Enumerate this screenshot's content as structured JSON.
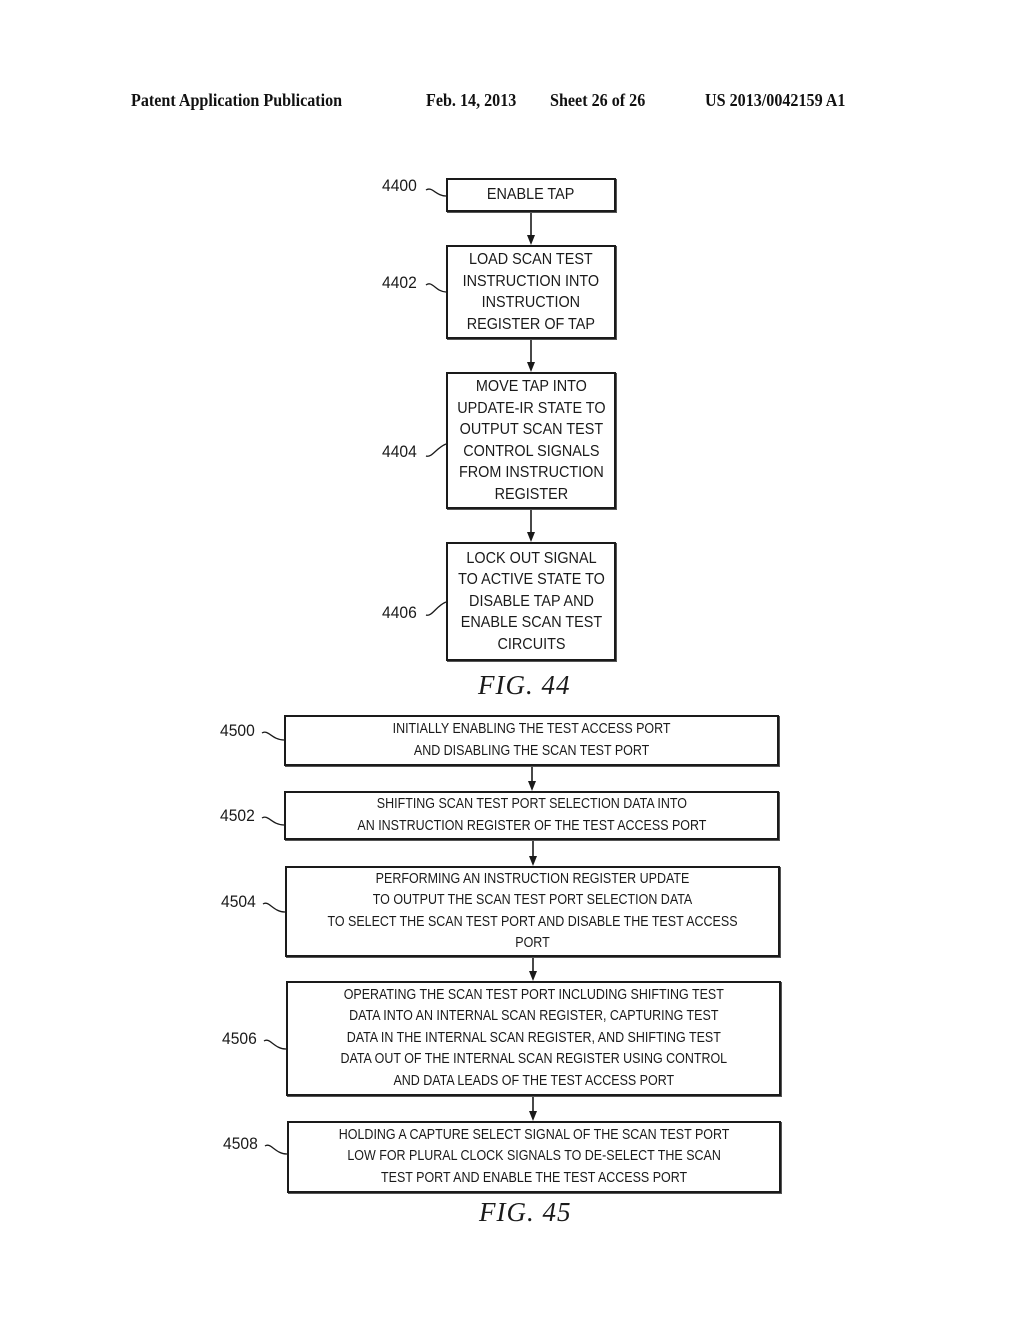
{
  "header": {
    "publication": "Patent Application Publication",
    "date": "Feb. 14, 2013",
    "sheet": "Sheet 26 of 26",
    "number": "US 2013/0042159 A1"
  },
  "fig44": {
    "caption": "FIG. 44",
    "steps": [
      {
        "ref": "4400",
        "text": "ENABLE TAP"
      },
      {
        "ref": "4402",
        "text": "LOAD SCAN TEST\nINSTRUCTION INTO\nINSTRUCTION\nREGISTER OF TAP"
      },
      {
        "ref": "4404",
        "text": "MOVE TAP INTO\nUPDATE-IR STATE TO\nOUTPUT SCAN TEST\nCONTROL SIGNALS\nFROM INSTRUCTION\nREGISTER"
      },
      {
        "ref": "4406",
        "text": "LOCK OUT SIGNAL\nTO ACTIVE STATE TO\nDISABLE TAP AND\nENABLE SCAN TEST\nCIRCUITS"
      }
    ]
  },
  "fig45": {
    "caption": "FIG. 45",
    "steps": [
      {
        "ref": "4500",
        "text": "INITIALLY ENABLING THE TEST ACCESS PORT\nAND DISABLING THE SCAN TEST PORT"
      },
      {
        "ref": "4502",
        "text": "SHIFTING SCAN TEST PORT SELECTION DATA INTO\nAN INSTRUCTION REGISTER OF THE TEST ACCESS PORT"
      },
      {
        "ref": "4504",
        "text": "PERFORMING AN INSTRUCTION REGISTER UPDATE\nTO OUTPUT THE SCAN TEST PORT SELECTION DATA\nTO SELECT THE SCAN TEST PORT AND DISABLE THE TEST ACCESS PORT"
      },
      {
        "ref": "4506",
        "text": "OPERATING THE SCAN TEST PORT INCLUDING SHIFTING TEST\nDATA INTO AN INTERNAL SCAN REGISTER, CAPTURING TEST\nDATA IN THE INTERNAL SCAN REGISTER, AND SHIFTING TEST\nDATA OUT OF THE INTERNAL SCAN REGISTER USING CONTROL\nAND DATA LEADS OF THE TEST ACCESS PORT"
      },
      {
        "ref": "4508",
        "text": "HOLDING A CAPTURE SELECT SIGNAL OF THE SCAN TEST PORT\nLOW FOR PLURAL CLOCK SIGNALS TO DE-SELECT THE SCAN\nTEST PORT AND ENABLE THE TEST ACCESS PORT"
      }
    ]
  }
}
